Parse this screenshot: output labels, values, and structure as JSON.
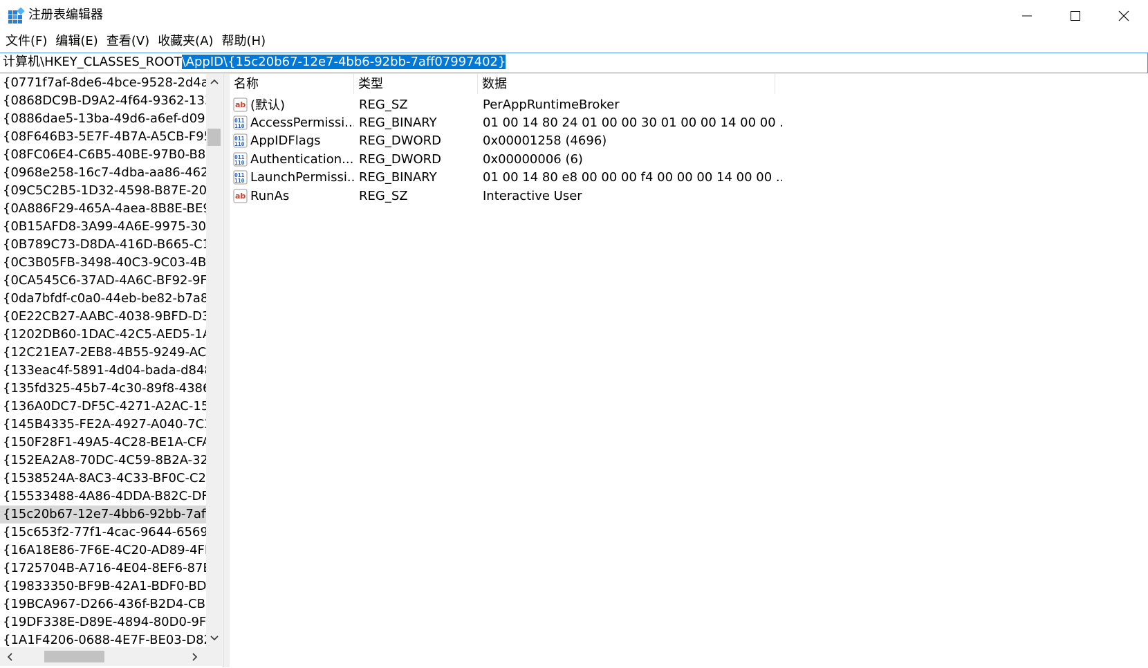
{
  "window": {
    "title": "注册表编辑器"
  },
  "menu": [
    "文件(F)",
    "编辑(E)",
    "查看(V)",
    "收藏夹(A)",
    "帮助(H)"
  ],
  "address": {
    "plain": "计算机\\HKEY_CLASSES_ROOT",
    "selected": "\\AppID\\{15c20b67-12e7-4bb6-92bb-7aff07997402}"
  },
  "tree": {
    "items": [
      "{0771f7af-8de6-4bce-9528-2d4a7",
      "{0868DC9B-D9A2-4f64-9362-133",
      "{0886dae5-13ba-49d6-a6ef-d092",
      "{08F646B3-5E7F-4B7A-A5CB-F95",
      "{08FC06E4-C6B5-40BE-97B0-B80",
      "{0968e258-16c7-4dba-aa86-462c",
      "{09C5C2B5-1D32-4598-B87E-203",
      "{0A886F29-465A-4aea-8B8E-BE9/",
      "{0B15AFD8-3A99-4A6E-9975-30I",
      "{0B789C73-D8DA-416D-B665-C1",
      "{0C3B05FB-3498-40C3-9C03-4B2",
      "{0CA545C6-37AD-4A6C-BF92-9F",
      "{0da7bfdf-c0a0-44eb-be82-b7a8",
      "{0E22CB27-AABC-4038-9BFD-D3",
      "{1202DB60-1DAC-42C5-AED5-1A",
      "{12C21EA7-2EB8-4B55-9249-AC2",
      "{133eac4f-5891-4d04-bada-d848",
      "{135fd325-45b7-4c30-89f8-4386",
      "{136A0DC7-DF5C-4271-A2AC-15",
      "{145B4335-FE2A-4927-A040-7C3",
      "{150F28F1-49A5-4C28-BE1A-CFA",
      "{152EA2A8-70DC-4C59-8B2A-32/",
      "{1538524A-8AC3-4C33-BF0C-C2I",
      "{15533488-4A86-4DDA-B82C-DF",
      "{15c20b67-12e7-4bb6-92bb-7aff",
      "{15c653f2-77f1-4cac-9644-65698",
      "{16A18E86-7F6E-4C20-AD89-4FF",
      "{1725704B-A716-4E04-8EF6-87EI",
      "{19833350-BF9B-42A1-BDF0-BD1",
      "{19BCA967-D266-436f-B2D4-CBE",
      "{19DF338E-D89E-4894-80D0-9FI",
      "{1A1F4206-0688-4E7F-BE03-D82"
    ],
    "selected_index": 24
  },
  "columns": {
    "name": "名称",
    "type": "类型",
    "data": "数据"
  },
  "values": [
    {
      "icon": "string-value-icon",
      "name": "(默认)",
      "type": "REG_SZ",
      "data": "PerAppRuntimeBroker"
    },
    {
      "icon": "binary-value-icon",
      "name": "AccessPermissi...",
      "type": "REG_BINARY",
      "data": "01 00 14 80 24 01 00 00 30 01 00 00 14 00 00 ..."
    },
    {
      "icon": "binary-value-icon",
      "name": "AppIDFlags",
      "type": "REG_DWORD",
      "data": "0x00001258 (4696)"
    },
    {
      "icon": "binary-value-icon",
      "name": "Authentication...",
      "type": "REG_DWORD",
      "data": "0x00000006 (6)"
    },
    {
      "icon": "binary-value-icon",
      "name": "LaunchPermissi...",
      "type": "REG_BINARY",
      "data": "01 00 14 80 e8 00 00 00 f4 00 00 00 14 00 00 ..."
    },
    {
      "icon": "string-value-icon",
      "name": "RunAs",
      "type": "REG_SZ",
      "data": "Interactive User"
    }
  ],
  "colors": {
    "selection": "#0078d7",
    "tree_selected": "#d9d9d9",
    "scrollbar": "#f0f0f0"
  }
}
